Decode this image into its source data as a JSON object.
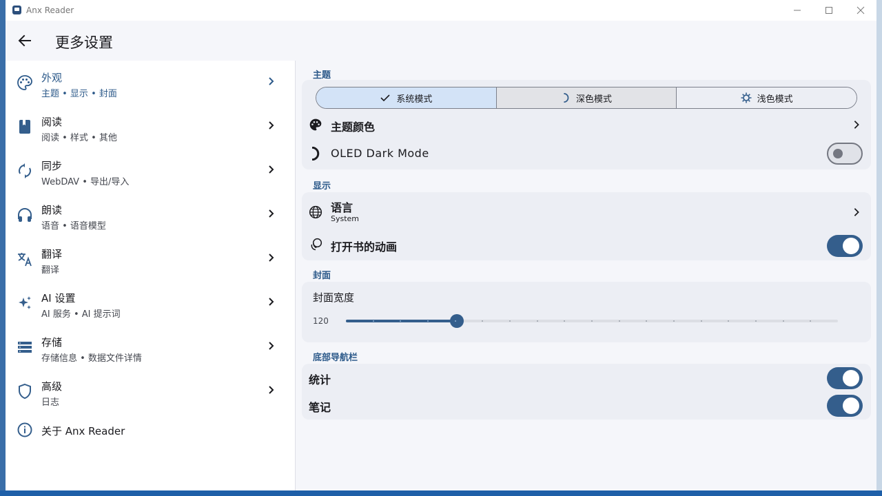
{
  "window": {
    "title": "Anx Reader"
  },
  "appbar": {
    "title": "更多设置"
  },
  "nav": [
    {
      "label": "外观",
      "sub": "主题 • 显示 • 封面",
      "icon": "palette-icon",
      "selected": true
    },
    {
      "label": "阅读",
      "sub": "阅读 • 样式 • 其他",
      "icon": "book-icon"
    },
    {
      "label": "同步",
      "sub": "WebDAV • 导出/导入",
      "icon": "sync-icon"
    },
    {
      "label": "朗读",
      "sub": "语音 • 语音模型",
      "icon": "headphones-icon"
    },
    {
      "label": "翻译",
      "sub": "翻译",
      "icon": "translate-icon"
    },
    {
      "label": "AI 设置",
      "sub": "AI 服务 • AI 提示词",
      "icon": "sparkle-icon"
    },
    {
      "label": "存储",
      "sub": "存储信息 • 数据文件详情",
      "icon": "storage-icon"
    },
    {
      "label": "高级",
      "sub": "日志",
      "icon": "shield-icon"
    },
    {
      "label": "关于 Anx Reader",
      "icon": "info-icon"
    }
  ],
  "theme": {
    "section": "主题",
    "modes": [
      "系统模式",
      "深色模式",
      "浅色模式"
    ],
    "selected_mode": "系统模式",
    "color_label": "主题颜色",
    "oled_label": "OLED Dark Mode",
    "oled_on": false
  },
  "display": {
    "section": "显示",
    "language_label": "语言",
    "language_value": "System",
    "animation_label": "打开书的动画",
    "animation_on": true
  },
  "cover": {
    "section": "封面",
    "width_label": "封面宽度",
    "width_value": "120",
    "slider_fraction": 0.225
  },
  "bottom_nav": {
    "section": "底部导航栏",
    "items": [
      {
        "label": "统计",
        "on": true
      },
      {
        "label": "笔记",
        "on": true
      }
    ]
  },
  "colors": {
    "accent": "#345e8c",
    "section_title": "#2d5a8a",
    "card_bg": "#eceef4"
  }
}
